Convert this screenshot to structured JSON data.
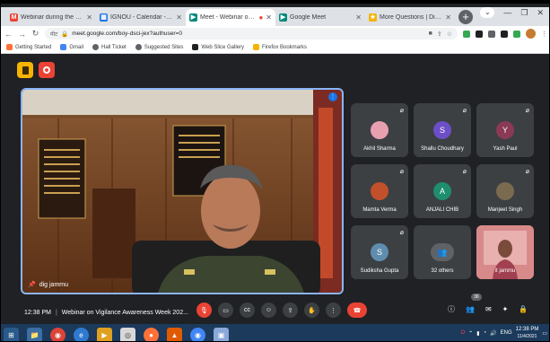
{
  "tabs": [
    {
      "favicon": "gmail-icon",
      "color": "#ea4335",
      "title": "Webinar during the vigilance"
    },
    {
      "favicon": "calendar-icon",
      "color": "#1a73e8",
      "title": "IGNOU - Calendar - Event de"
    },
    {
      "favicon": "meet-icon",
      "color": "#00897b",
      "title": "Meet - Webinar on Vigila",
      "active": true
    },
    {
      "favicon": "meet-icon",
      "color": "#00897b",
      "title": "Google Meet"
    },
    {
      "favicon": "directorate-icon",
      "color": "#f4b400",
      "title": "More Questions | Directorat"
    }
  ],
  "address": {
    "url": "meet.google.com/boy-dsci-jex?authuser=0",
    "lock_label": "मीट"
  },
  "bookmarks": [
    {
      "label": "Getting Started",
      "color": "#ff7139"
    },
    {
      "label": "Gmail",
      "color": "#4285f4"
    },
    {
      "label": "Hall Ticket",
      "color": "#5f6368"
    },
    {
      "label": "Suggested Sites",
      "color": "#5f6368"
    },
    {
      "label": "Web Slice Gallery",
      "color": "#202124"
    },
    {
      "label": "Firefox Bookmarks",
      "color": "#f4b400"
    }
  ],
  "speaker": {
    "name": "dig jammu"
  },
  "participants": [
    {
      "name": "Akhil Sharma",
      "initial": "",
      "avatar": "photo",
      "color": "#e8a0b0"
    },
    {
      "name": "Shallu Choudhary",
      "initial": "S",
      "avatar": "letter",
      "color": "#6c4fc8"
    },
    {
      "name": "Yash Paul",
      "initial": "Y",
      "avatar": "letter",
      "color": "#8a3a55"
    },
    {
      "name": "Mamta Verma",
      "initial": "",
      "avatar": "photo",
      "color": "#c2502a"
    },
    {
      "name": "ANJALI CHIB",
      "initial": "A",
      "avatar": "letter",
      "color": "#1e8e6e"
    },
    {
      "name": "Manjeet Singh",
      "initial": "",
      "avatar": "photo",
      "color": "#7a6a50"
    },
    {
      "name": "Sudiksha Gupta",
      "initial": "S",
      "avatar": "letter",
      "color": "#5f8dad"
    },
    {
      "name": "32 others",
      "initial": "",
      "avatar": "group",
      "color": "#5f6368"
    },
    {
      "name": "it jammu",
      "initial": "",
      "avatar": "video",
      "color": "#c9706a"
    }
  ],
  "meeting": {
    "time": "12:38 PM",
    "title": "Webinar on Vigilance Awareness Week 202...",
    "people_count": "36"
  },
  "taskbar": {
    "time": "12:38 PM",
    "date": "11/4/2021"
  }
}
